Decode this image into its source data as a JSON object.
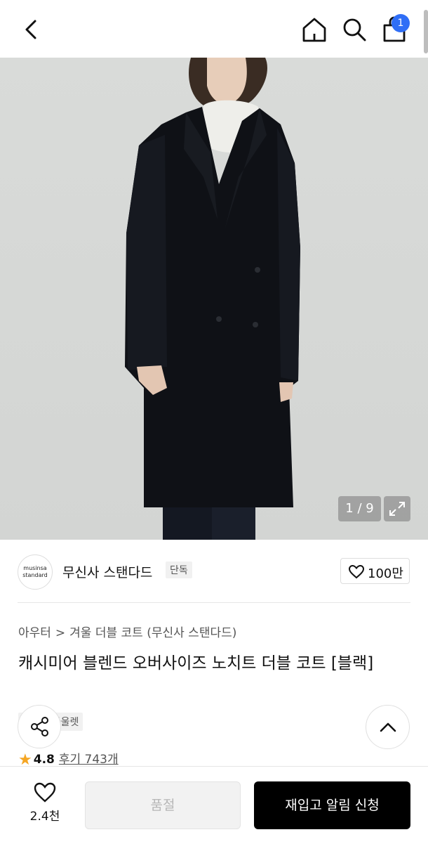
{
  "header": {
    "icons": [
      "back-icon",
      "home-icon",
      "search-icon",
      "cart-icon"
    ],
    "cart_badge": "1",
    "accent": "#2f6ef6"
  },
  "gallery": {
    "counter": "1 / 9",
    "icons": [
      "expand-icon"
    ]
  },
  "brand": {
    "logo_text_line1": "musinsa",
    "logo_text_line2": "standard",
    "name": "무신사 스탠다드",
    "tag": "단독",
    "likes": "100만"
  },
  "product": {
    "breadcrumb": [
      "아우터",
      "겨울 더블 코트 (무신사 스탠다드)"
    ],
    "title": "캐시미어 블렌드 오버사이즈 노치트 더블 코트 [블랙]",
    "tags": [
      "단독",
      "아울렛"
    ],
    "rating": "4.8",
    "reviews": "후기 743개"
  },
  "bottom_bar": {
    "wish_count": "2.4천",
    "soldout_label": "품절",
    "restock_label": "재입고 알림 신청"
  }
}
